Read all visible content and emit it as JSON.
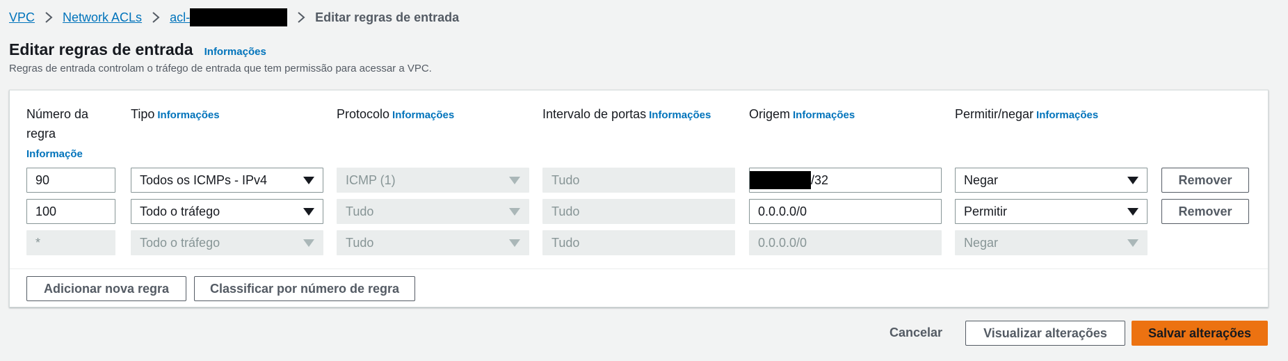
{
  "breadcrumb": {
    "vpc": "VPC",
    "nacls": "Network ACLs",
    "acl_prefix": "acl-",
    "current": "Editar regras de entrada"
  },
  "header": {
    "title": "Editar regras de entrada",
    "info": "Informações",
    "description": "Regras de entrada controlam o tráfego de entrada que tem permissão para acessar a VPC."
  },
  "columns": {
    "rule_number_line1": "Número da",
    "rule_number_line2": "regra",
    "type": "Tipo",
    "protocol": "Protocolo",
    "port_range": "Intervalo de portas",
    "source": "Origem",
    "allow_deny": "Permitir/negar",
    "info": "Informações",
    "info_part1": "Informaçõe",
    "info_part2": "s"
  },
  "rows": [
    {
      "rule_number": "90",
      "type": "Todos os ICMPs - IPv4",
      "protocol": "ICMP (1)",
      "port_range": "Tudo",
      "source_suffix": "/32",
      "allow_deny": "Negar",
      "remove": "Remover"
    },
    {
      "rule_number": "100",
      "type": "Todo o tráfego",
      "protocol": "Tudo",
      "port_range": "Tudo",
      "source": "0.0.0.0/0",
      "allow_deny": "Permitir",
      "remove": "Remover"
    },
    {
      "rule_number": "*",
      "type": "Todo o tráfego",
      "protocol": "Tudo",
      "port_range": "Tudo",
      "source": "0.0.0.0/0",
      "allow_deny": "Negar"
    }
  ],
  "panel_actions": {
    "add_rule": "Adicionar nova regra",
    "sort": "Classificar por número de regra"
  },
  "footer": {
    "cancel": "Cancelar",
    "preview": "Visualizar alterações",
    "save": "Salvar alterações"
  },
  "colors": {
    "link": "#0073bb",
    "primary": "#ec7211",
    "disabled_bg": "#eaeded"
  }
}
